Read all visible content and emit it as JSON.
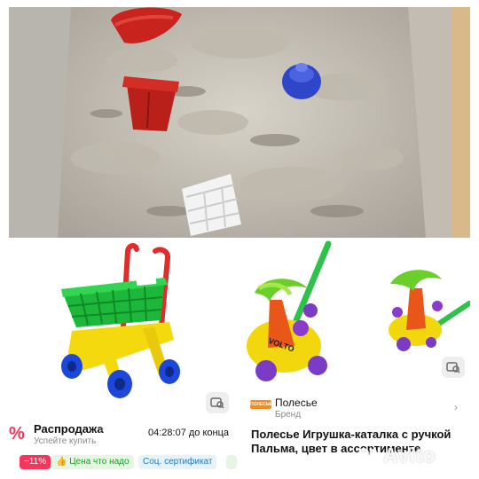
{
  "left_card": {
    "sale_icon": "%",
    "sale_title": "Распродажа",
    "sale_subtitle": "Успейте купить",
    "timer": "04:28:07 до конца",
    "tags": {
      "discount": "−11%",
      "price": "Цена что надо",
      "certificate": "Соц. сертификат"
    },
    "chevron": "›"
  },
  "right_card": {
    "brand_logo_text": "ПОЛЕСЬЕ",
    "brand_name": "Полесье",
    "brand_subtitle": "Бренд",
    "chevron": "›",
    "product_title": "Полесье Игрушка-каталка с ручкой Пальма, цвет в ассортименте",
    "toy_label": "VOLTO"
  },
  "watermark": {
    "text": "Avito"
  },
  "colors": {
    "sale_red": "#f5365c",
    "price_green": "#1a9e2a",
    "cert_blue": "#1f7ab8",
    "brand_orange": "#f58b1f"
  },
  "icons": {
    "sale": "percent-icon",
    "photo_search": "photo-search-icon",
    "price_tag": "thumb-up-icon",
    "avito_logo": "avito-dots-icon"
  }
}
